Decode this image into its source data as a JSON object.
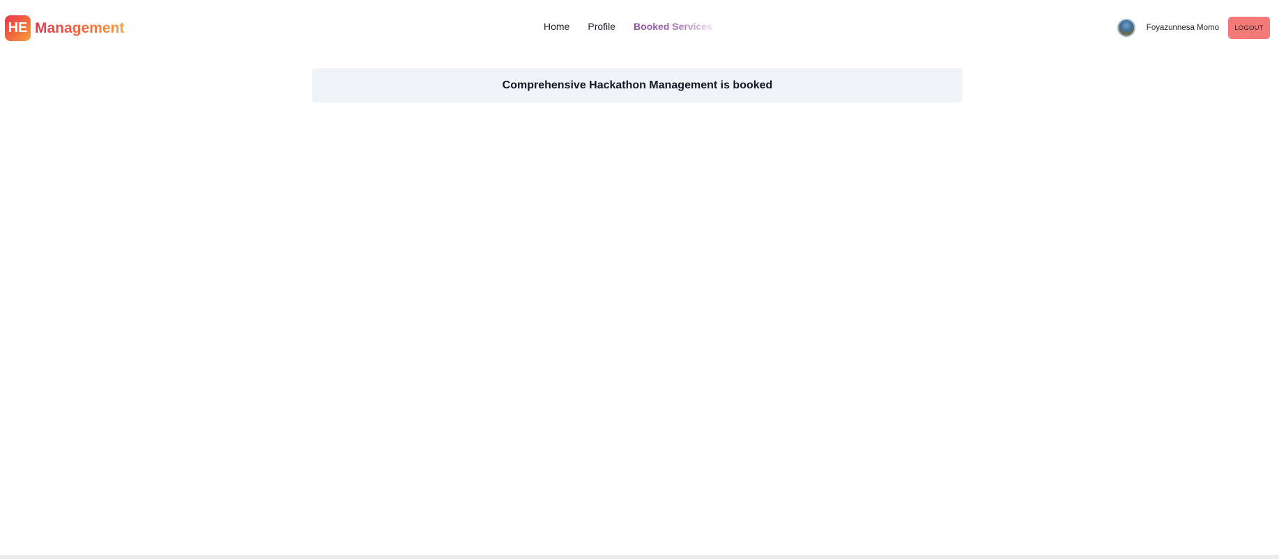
{
  "brand": {
    "badge": "HE",
    "name": "Management"
  },
  "nav": {
    "links": [
      {
        "label": "Home"
      },
      {
        "label": "Profile"
      },
      {
        "label": "Booked Services"
      }
    ]
  },
  "user": {
    "avatar_icon": "user-avatar",
    "name": "Foyazunnesa Momo",
    "logout_label": "LOGOUT"
  },
  "booking": {
    "message": "Comprehensive Hackathon Management is booked"
  },
  "colors": {
    "brand_gradient_start": "#e8344f",
    "brand_gradient_end": "#f6a13a",
    "active_link": "#8b4f9c",
    "logout_bg": "#f47a7a",
    "card_bg": "#f0f3f8"
  }
}
